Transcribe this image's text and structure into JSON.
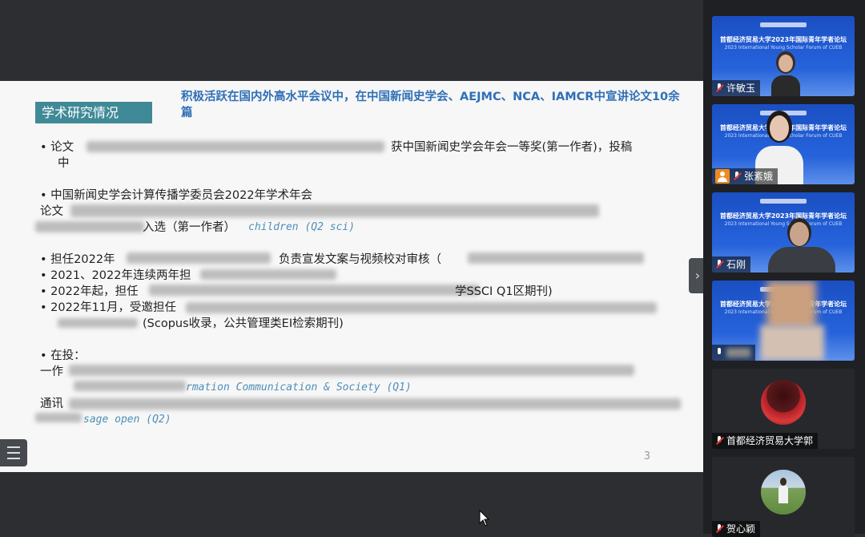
{
  "slide": {
    "section_tag": "学术研究情况",
    "headline": "积极活跃在国内外高水平会议中，在中国新闻史学会、AEJMC、NCA、IAMCR中宣讲论文10余篇",
    "lines": {
      "b1_prefix": "• 论文",
      "b1_suffix": "获中国新闻史学会年会一等奖(第一作者)，投稿",
      "b1_wrap": "中",
      "b2": "• 中国新闻史学会计算传播学委员会2022年学术年会",
      "b2_paper": "论文",
      "b2_select": "入选（第一作者）",
      "b2_journal": "children (Q2 sci)",
      "b3": "• 担任2022年",
      "b3_suffix": "负责宣发文案与视频校对审核（",
      "b4": "• 2021、2022年连续两年担",
      "b5_prefix": "• 2022年起，担任",
      "b5_suffix": "学SSCI Q1区期刊)",
      "b6": "• 2022年11月，受邀担任",
      "b6_wrap": "(Scopus收录，公共管理类EI检索期刊)",
      "b7": "• 在投：",
      "b7_first": "一作",
      "b7_journal1": "rmation Communication & Society (Q1)",
      "b7_corr": "通讯",
      "b7_journal2": "sage open (Q2)"
    },
    "page_number": "3"
  },
  "participants": [
    {
      "name": "许敏玉",
      "banner": "首都经济贸易大学2023年国际青年学者论坛",
      "banner_sub": "2023 International Young Scholar Forum of CUEB"
    },
    {
      "name": "张紊娥",
      "banner": "首都经济贸易大学2023年国际青年学者论坛",
      "banner_sub": "2023 International Young Scholar Forum of CUEB"
    },
    {
      "name": "石刚",
      "banner": "首都经济贸易大学2023年国际青年学者论坛",
      "banner_sub": "2023 International Young Scholar Forum of CUEB"
    },
    {
      "name": "",
      "banner": "首都经济贸易大学2023年国际青年学者论坛",
      "banner_sub": "2023 International Young Scholar Forum of CUEB"
    },
    {
      "name": "首都经济贸易大学郭"
    },
    {
      "name": "贺心颖"
    }
  ],
  "colors": {
    "accent_teal": "#3f8a96",
    "headline_blue": "#2f6fb7",
    "tile_blue": "#2460d8"
  }
}
